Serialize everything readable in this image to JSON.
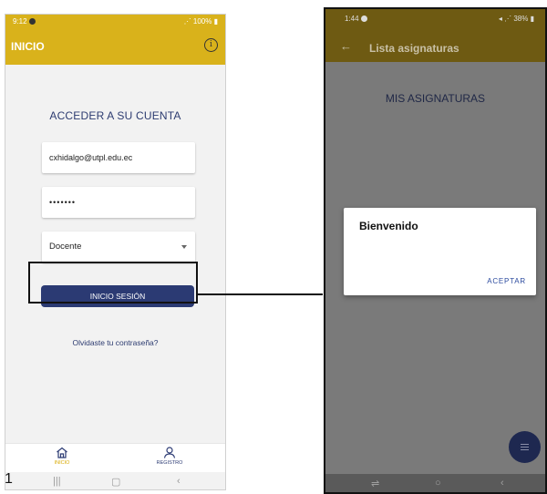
{
  "phone1": {
    "status_time": "9:12",
    "status_right": "100%",
    "app_title": "INICIO",
    "info_icon": "info-icon",
    "heading": "ACCEDER A SU CUENTA",
    "email_value": "cxhidalgo@utpl.edu.ec",
    "password_value": "•••••••",
    "role_value": "Docente",
    "login_button": "INICIO SESIÓN",
    "forgot_link": "Olvidaste tu contraseña?",
    "nav": {
      "home_label": "INICIO",
      "register_label": "REGISTRO"
    },
    "colors": {
      "primary": "#d9b21b",
      "button": "#2b3a73"
    }
  },
  "figure_label": "1",
  "phone2": {
    "status_time": "1:44",
    "status_right": "38%",
    "app_title": "Lista asignaturas",
    "heading": "MIS ASIGNATURAS",
    "dialog": {
      "title": "Bienvenido",
      "ok_button": "ACEPTAR"
    },
    "colors": {
      "appbar": "#6e5a12",
      "fab": "#1e2850"
    }
  }
}
